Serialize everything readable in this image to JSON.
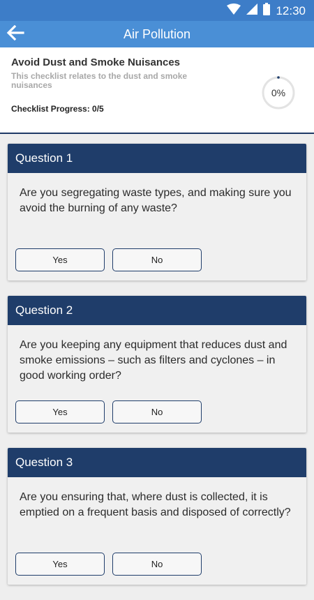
{
  "status_bar": {
    "time": "12:30",
    "icons": [
      "wifi-icon",
      "signal-icon",
      "battery-icon"
    ]
  },
  "app_bar": {
    "title": "Air Pollution",
    "back_icon": "arrow-left-icon"
  },
  "checklist": {
    "title": "Avoid Dust and Smoke Nuisances",
    "description": "This checklist relates to the dust and smoke nuisances",
    "progress_label": "Checklist Progress: 0/5",
    "progress_percent": "0%",
    "progress_fraction": 0
  },
  "questions": [
    {
      "header": "Question 1",
      "text": "Are you segregating waste types, and making sure you avoid the burning of any waste?",
      "yes_label": "Yes",
      "no_label": "No"
    },
    {
      "header": "Question 2",
      "text": "Are you keeping any equipment that reduces dust and smoke emissions – such as filters and cyclones – in good working order?",
      "yes_label": "Yes",
      "no_label": "No"
    },
    {
      "header": "Question 3",
      "text": "Are you ensuring that, where dust is collected, it is emptied on a frequent basis and disposed of correctly?",
      "yes_label": "Yes",
      "no_label": "No"
    }
  ],
  "colors": {
    "status_bar": "#3d7dc8",
    "app_bar": "#4a8fd6",
    "card_header": "#1f3d6a",
    "header_border": "#1f3a66"
  }
}
